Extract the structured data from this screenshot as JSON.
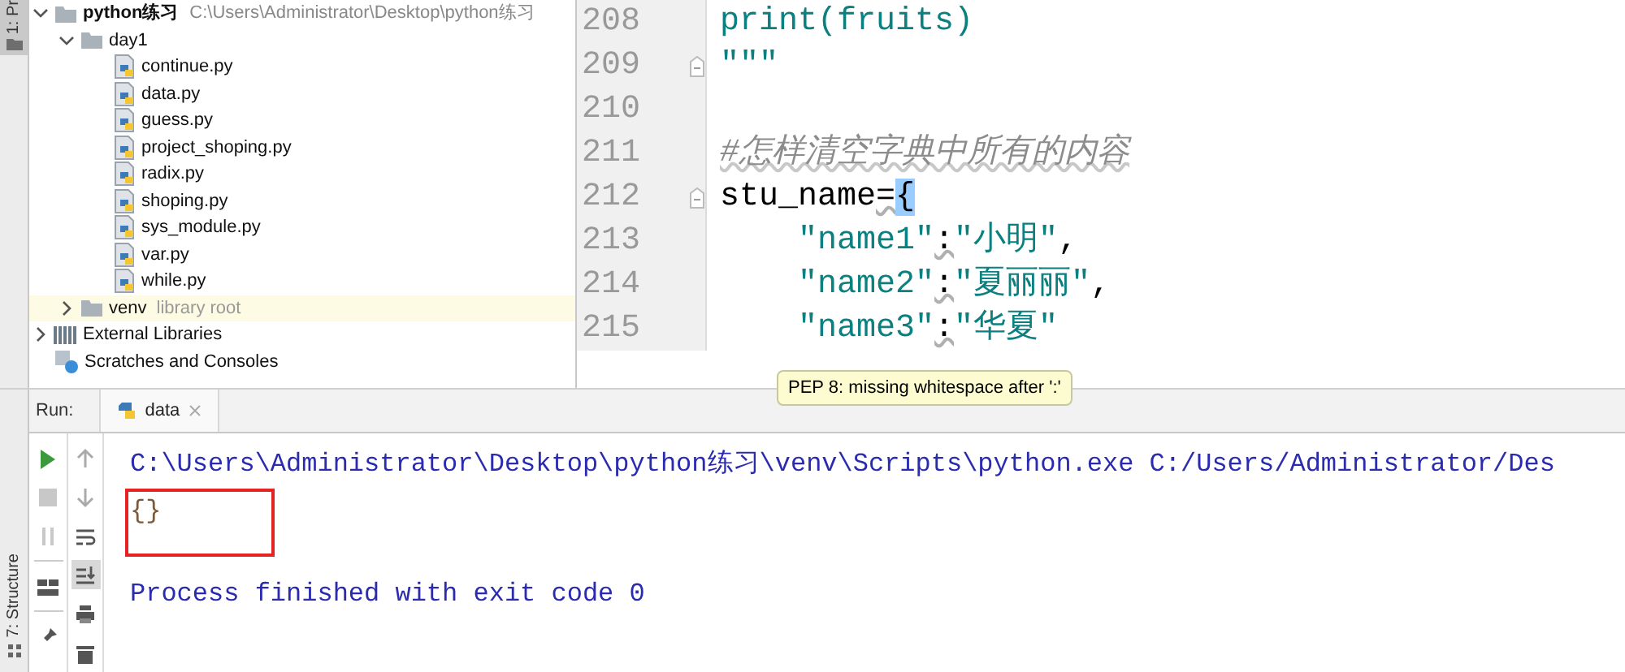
{
  "sidebar_tabs": [
    {
      "label": "1: Pr",
      "selected": true
    },
    {
      "label": "7: Structure",
      "selected": false
    }
  ],
  "project_tree": [
    {
      "label": "python练习",
      "path": "C:\\Users\\Administrator\\Desktop\\python练习",
      "kind": "folder",
      "expanded": true,
      "selected": false,
      "children": [
        {
          "label": "day1",
          "kind": "folder",
          "expanded": true,
          "selected": false,
          "children": [
            {
              "label": "continue.py",
              "kind": "file",
              "selected": false
            },
            {
              "label": "data.py",
              "kind": "file",
              "selected": false
            },
            {
              "label": "guess.py",
              "kind": "file",
              "selected": false
            },
            {
              "label": "project_shoping.py",
              "kind": "file",
              "selected": false
            },
            {
              "label": "radix.py",
              "kind": "file",
              "selected": false
            },
            {
              "label": "shoping.py",
              "kind": "file",
              "selected": false
            },
            {
              "label": "sys_module.py",
              "kind": "file",
              "selected": false
            },
            {
              "label": "var.py",
              "kind": "file",
              "selected": false
            },
            {
              "label": "while.py",
              "kind": "file",
              "selected": false
            }
          ]
        },
        {
          "label": "venv",
          "hint": "library root",
          "kind": "folder",
          "expanded": false,
          "selected": true
        }
      ]
    },
    {
      "label": "External Libraries",
      "kind": "libraries",
      "expanded": false,
      "selected": false
    },
    {
      "label": "Scratches and Consoles",
      "kind": "scratches",
      "selected": false
    }
  ],
  "editor": {
    "lines": [
      {
        "number": "208",
        "fold": false,
        "tokens": [
          {
            "text": "print(fruits)",
            "kind": "string"
          }
        ]
      },
      {
        "number": "209",
        "fold": true,
        "tokens": [
          {
            "text": "\"\"\"",
            "kind": "string"
          }
        ]
      },
      {
        "number": "210",
        "fold": false
      },
      {
        "number": "211",
        "fold": false,
        "tokens": [
          {
            "text": "#怎样清空字典中所有的内容",
            "kind": "comment"
          }
        ]
      },
      {
        "number": "212",
        "fold": true,
        "tokens": [
          {
            "text": "stu_name",
            "kind": "plain"
          },
          {
            "text": "=",
            "kind": "warn"
          },
          {
            "text": "{",
            "kind": "match"
          }
        ]
      },
      {
        "number": "213",
        "fold": false,
        "tokens": [
          {
            "text": "    \"name1\"",
            "kind": "string"
          },
          {
            "text": ":",
            "kind": "warn"
          },
          {
            "text": "\"小明\"",
            "kind": "string"
          },
          {
            "text": ",",
            "kind": "plain"
          }
        ]
      },
      {
        "number": "214",
        "fold": false,
        "tokens": [
          {
            "text": "    \"name2\"",
            "kind": "string"
          },
          {
            "text": ":",
            "kind": "warn"
          },
          {
            "text": "\"夏丽丽\"",
            "kind": "string"
          },
          {
            "text": ",",
            "kind": "plain"
          }
        ]
      },
      {
        "number": "215",
        "fold": false,
        "tokens": [
          {
            "text": "    \"name3\"",
            "kind": "string"
          },
          {
            "text": ":",
            "kind": "warn"
          },
          {
            "text": "\"华夏\"",
            "kind": "string"
          }
        ]
      }
    ],
    "tooltip": "PEP 8: missing whitespace after ':'"
  },
  "run_panel": {
    "label": "Run:",
    "tabs": [
      {
        "label": "data",
        "selected": true
      }
    ],
    "left_tools": [
      {
        "kind": "run",
        "disabled": false
      },
      {
        "kind": "stop",
        "disabled": true
      },
      {
        "kind": "pause",
        "disabled": true
      },
      {
        "kind": "layout",
        "disabled": false
      },
      {
        "kind": "pin",
        "disabled": false
      }
    ],
    "right_tools": [
      {
        "kind": "up",
        "selected": false
      },
      {
        "kind": "down",
        "selected": false
      },
      {
        "kind": "wrap",
        "selected": false
      },
      {
        "kind": "scroll",
        "selected": true
      },
      {
        "kind": "print",
        "selected": false
      },
      {
        "kind": "trash",
        "selected": false
      }
    ],
    "console": [
      {
        "text": "C:\\Users\\Administrator\\Desktop\\python练习\\venv\\Scripts\\python.exe C:/Users/Administrator/Des",
        "kind": "command",
        "boxed": false
      },
      {
        "text": "{}",
        "kind": "output",
        "boxed": true
      },
      {
        "text": "Process finished with exit code 0",
        "kind": "status",
        "boxed": false
      }
    ]
  }
}
